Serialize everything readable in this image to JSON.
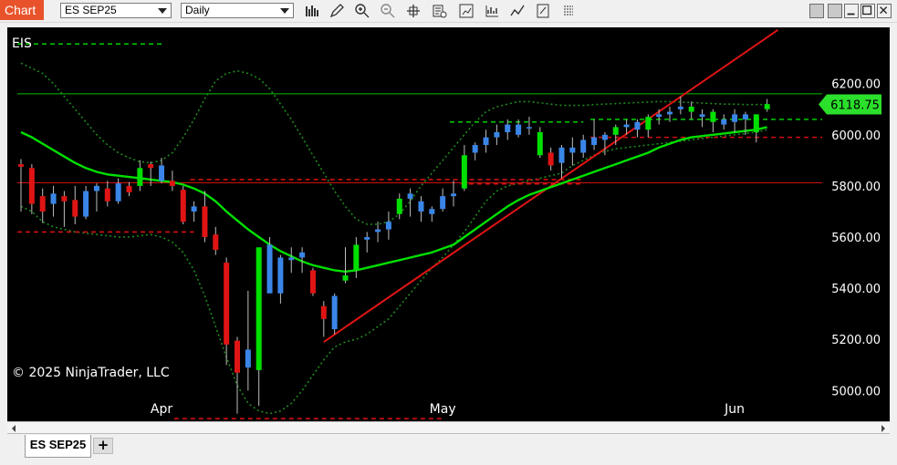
{
  "window": {
    "title_tab": "Chart",
    "instrument_value": "ES SEP25",
    "interval_value": "Daily"
  },
  "toolbar_icons": [
    "bars-icon",
    "pencil-icon",
    "zoom-in-icon",
    "zoom-out-icon",
    "crosshair-icon",
    "data-box-icon",
    "strategies-icon",
    "indicators-icon",
    "drawing-tools-icon",
    "properties-icon",
    "more-icon"
  ],
  "window_buttons": [
    "minimize-grey-icon",
    "minimize-icon",
    "maximize-icon",
    "close-icon"
  ],
  "chart_data": {
    "type": "candlestick",
    "symbol_label": "EIS",
    "copyright": "© 2025 NinjaTrader, LLC",
    "last_price": "6118.75",
    "y_ticks": [
      "6200.00",
      "6000.00",
      "5800.00",
      "5600.00",
      "5400.00",
      "5200.00",
      "5000.00"
    ],
    "x_ticks": [
      "Apr",
      "May",
      "Jun"
    ],
    "ylim": [
      4880,
      6420
    ],
    "x_index_ticks": [
      13,
      39,
      66
    ],
    "colors": {
      "up": "#00e000",
      "down": "#e01414",
      "up_hollow": "#3a86e8",
      "sma": "#00e000",
      "bands": "#1f8a1f",
      "trendline": "#e01414",
      "hline_green": "#00c000",
      "hline_red": "#d01010",
      "price_tag": "#2be02b"
    },
    "candles": [
      {
        "o": 5885,
        "h": 5905,
        "l": 5700,
        "c": 5875,
        "col": "down"
      },
      {
        "o": 5870,
        "h": 5885,
        "l": 5690,
        "c": 5730,
        "col": "down"
      },
      {
        "o": 5760,
        "h": 5790,
        "l": 5655,
        "c": 5700,
        "col": "down"
      },
      {
        "o": 5730,
        "h": 5800,
        "l": 5680,
        "c": 5770,
        "col": "blue"
      },
      {
        "o": 5760,
        "h": 5780,
        "l": 5640,
        "c": 5740,
        "col": "down"
      },
      {
        "o": 5745,
        "h": 5800,
        "l": 5650,
        "c": 5680,
        "col": "down"
      },
      {
        "o": 5680,
        "h": 5800,
        "l": 5670,
        "c": 5780,
        "col": "blue"
      },
      {
        "o": 5780,
        "h": 5810,
        "l": 5700,
        "c": 5800,
        "col": "blue"
      },
      {
        "o": 5790,
        "h": 5820,
        "l": 5720,
        "c": 5740,
        "col": "down"
      },
      {
        "o": 5740,
        "h": 5830,
        "l": 5730,
        "c": 5810,
        "col": "blue"
      },
      {
        "o": 5800,
        "h": 5815,
        "l": 5760,
        "c": 5775,
        "col": "down"
      },
      {
        "o": 5800,
        "h": 5900,
        "l": 5780,
        "c": 5870,
        "col": "up"
      },
      {
        "o": 5870,
        "h": 5895,
        "l": 5800,
        "c": 5885,
        "col": "down"
      },
      {
        "o": 5880,
        "h": 5910,
        "l": 5810,
        "c": 5820,
        "col": "blue"
      },
      {
        "o": 5820,
        "h": 5860,
        "l": 5780,
        "c": 5800,
        "col": "down"
      },
      {
        "o": 5785,
        "h": 5800,
        "l": 5650,
        "c": 5660,
        "col": "down"
      },
      {
        "o": 5700,
        "h": 5740,
        "l": 5660,
        "c": 5720,
        "col": "blue"
      },
      {
        "o": 5720,
        "h": 5780,
        "l": 5580,
        "c": 5600,
        "col": "down"
      },
      {
        "o": 5610,
        "h": 5640,
        "l": 5530,
        "c": 5550,
        "col": "down"
      },
      {
        "o": 5500,
        "h": 5520,
        "l": 5100,
        "c": 5180,
        "col": "down"
      },
      {
        "o": 5195,
        "h": 5210,
        "l": 4910,
        "c": 5070,
        "col": "down"
      },
      {
        "o": 5090,
        "h": 5390,
        "l": 5000,
        "c": 5160,
        "col": "blue"
      },
      {
        "o": 5080,
        "h": 5520,
        "l": 4940,
        "c": 5560,
        "col": "up"
      },
      {
        "o": 5570,
        "h": 5600,
        "l": 5440,
        "c": 5380,
        "col": "blue"
      },
      {
        "o": 5380,
        "h": 5530,
        "l": 5340,
        "c": 5520,
        "col": "blue"
      },
      {
        "o": 5510,
        "h": 5560,
        "l": 5460,
        "c": 5520,
        "col": "blue"
      },
      {
        "o": 5520,
        "h": 5560,
        "l": 5460,
        "c": 5540,
        "col": "blue"
      },
      {
        "o": 5470,
        "h": 5480,
        "l": 5370,
        "c": 5380,
        "col": "down"
      },
      {
        "o": 5330,
        "h": 5350,
        "l": 5210,
        "c": 5280,
        "col": "down"
      },
      {
        "o": 5240,
        "h": 5380,
        "l": 5220,
        "c": 5370,
        "col": "blue"
      },
      {
        "o": 5430,
        "h": 5560,
        "l": 5420,
        "c": 5450,
        "col": "up"
      },
      {
        "o": 5470,
        "h": 5600,
        "l": 5440,
        "c": 5570,
        "col": "up"
      },
      {
        "o": 5590,
        "h": 5620,
        "l": 5540,
        "c": 5600,
        "col": "blue"
      },
      {
        "o": 5620,
        "h": 5660,
        "l": 5580,
        "c": 5630,
        "col": "blue"
      },
      {
        "o": 5630,
        "h": 5700,
        "l": 5590,
        "c": 5660,
        "col": "blue"
      },
      {
        "o": 5690,
        "h": 5770,
        "l": 5670,
        "c": 5750,
        "col": "up"
      },
      {
        "o": 5750,
        "h": 5790,
        "l": 5680,
        "c": 5770,
        "col": "blue"
      },
      {
        "o": 5740,
        "h": 5760,
        "l": 5660,
        "c": 5700,
        "col": "blue"
      },
      {
        "o": 5690,
        "h": 5720,
        "l": 5660,
        "c": 5710,
        "col": "blue"
      },
      {
        "o": 5710,
        "h": 5790,
        "l": 5700,
        "c": 5760,
        "col": "blue"
      },
      {
        "o": 5770,
        "h": 5820,
        "l": 5720,
        "c": 5760,
        "col": "blue"
      },
      {
        "o": 5790,
        "h": 5960,
        "l": 5780,
        "c": 5920,
        "col": "up"
      },
      {
        "o": 5930,
        "h": 5970,
        "l": 5900,
        "c": 5960,
        "col": "blue"
      },
      {
        "o": 5960,
        "h": 6020,
        "l": 5930,
        "c": 5990,
        "col": "blue"
      },
      {
        "o": 5990,
        "h": 6040,
        "l": 5960,
        "c": 6010,
        "col": "blue"
      },
      {
        "o": 6010,
        "h": 6060,
        "l": 5980,
        "c": 6040,
        "col": "blue"
      },
      {
        "o": 6040,
        "h": 6060,
        "l": 5990,
        "c": 6000,
        "col": "blue"
      },
      {
        "o": 6030,
        "h": 6070,
        "l": 6000,
        "c": 6030,
        "col": "blue"
      },
      {
        "o": 6010,
        "h": 6030,
        "l": 5910,
        "c": 5920,
        "col": "up"
      },
      {
        "o": 5930,
        "h": 5950,
        "l": 5860,
        "c": 5880,
        "col": "down"
      },
      {
        "o": 5890,
        "h": 5960,
        "l": 5830,
        "c": 5950,
        "col": "blue"
      },
      {
        "o": 5950,
        "h": 5990,
        "l": 5880,
        "c": 5930,
        "col": "blue"
      },
      {
        "o": 5930,
        "h": 6000,
        "l": 5910,
        "c": 5980,
        "col": "blue"
      },
      {
        "o": 5990,
        "h": 6060,
        "l": 5940,
        "c": 5960,
        "col": "blue"
      },
      {
        "o": 5980,
        "h": 6010,
        "l": 5920,
        "c": 6000,
        "col": "blue"
      },
      {
        "o": 6000,
        "h": 6040,
        "l": 5960,
        "c": 6030,
        "col": "up"
      },
      {
        "o": 6030,
        "h": 6060,
        "l": 6000,
        "c": 6040,
        "col": "blue"
      },
      {
        "o": 6020,
        "h": 6060,
        "l": 5990,
        "c": 6050,
        "col": "blue"
      },
      {
        "o": 6020,
        "h": 6080,
        "l": 5990,
        "c": 6070,
        "col": "up"
      },
      {
        "o": 6070,
        "h": 6100,
        "l": 6040,
        "c": 6080,
        "col": "blue"
      },
      {
        "o": 6080,
        "h": 6110,
        "l": 6050,
        "c": 6090,
        "col": "blue"
      },
      {
        "o": 6100,
        "h": 6150,
        "l": 6080,
        "c": 6110,
        "col": "blue"
      },
      {
        "o": 6110,
        "h": 6130,
        "l": 6060,
        "c": 6090,
        "col": "up"
      },
      {
        "o": 6080,
        "h": 6100,
        "l": 6030,
        "c": 6070,
        "col": "blue"
      },
      {
        "o": 6050,
        "h": 6100,
        "l": 6010,
        "c": 6090,
        "col": "up"
      },
      {
        "o": 6060,
        "h": 6080,
        "l": 6020,
        "c": 6040,
        "col": "blue"
      },
      {
        "o": 6050,
        "h": 6100,
        "l": 6010,
        "c": 6080,
        "col": "blue"
      },
      {
        "o": 6080,
        "h": 6090,
        "l": 6000,
        "c": 6060,
        "col": "blue"
      },
      {
        "o": 6010,
        "h": 6080,
        "l": 5970,
        "c": 6080,
        "col": "up"
      },
      {
        "o": 6100,
        "h": 6140,
        "l": 6090,
        "c": 6120,
        "col": "up"
      }
    ],
    "sma": [
      6010,
      5990,
      5965,
      5940,
      5915,
      5890,
      5870,
      5855,
      5845,
      5840,
      5835,
      5830,
      5825,
      5820,
      5815,
      5805,
      5790,
      5770,
      5740,
      5700,
      5665,
      5630,
      5600,
      5570,
      5545,
      5525,
      5505,
      5490,
      5480,
      5470,
      5465,
      5470,
      5480,
      5490,
      5500,
      5510,
      5520,
      5530,
      5540,
      5555,
      5570,
      5600,
      5630,
      5660,
      5690,
      5720,
      5745,
      5765,
      5780,
      5795,
      5810,
      5825,
      5840,
      5855,
      5870,
      5885,
      5900,
      5915,
      5930,
      5950,
      5965,
      5980,
      5990,
      5995,
      6000,
      6005,
      6010,
      6015,
      6020,
      6030
    ],
    "band_upper": [
      6280,
      6260,
      6240,
      6200,
      6150,
      6100,
      6050,
      6000,
      5960,
      5930,
      5910,
      5895,
      5890,
      5900,
      5930,
      5990,
      6060,
      6140,
      6210,
      6240,
      6250,
      6240,
      6220,
      6180,
      6120,
      6060,
      5990,
      5920,
      5850,
      5780,
      5720,
      5670,
      5650,
      5650,
      5660,
      5690,
      5740,
      5800,
      5850,
      5900,
      5950,
      6000,
      6050,
      6090,
      6110,
      6120,
      6130,
      6130,
      6125,
      6120,
      6115,
      6115,
      6115,
      6118,
      6120,
      6122,
      6124,
      6126,
      6128,
      6130,
      6130,
      6128,
      6126,
      6124,
      6122,
      6120,
      6120,
      6118,
      6118,
      6118
    ],
    "band_lower": [
      5720,
      5700,
      5660,
      5640,
      5630,
      5620,
      5615,
      5610,
      5605,
      5600,
      5600,
      5605,
      5610,
      5600,
      5580,
      5540,
      5470,
      5370,
      5250,
      5130,
      5020,
      4950,
      4920,
      4910,
      4920,
      4950,
      5000,
      5060,
      5120,
      5170,
      5190,
      5200,
      5220,
      5250,
      5280,
      5330,
      5380,
      5430,
      5480,
      5520,
      5570,
      5620,
      5680,
      5740,
      5780,
      5800,
      5810,
      5820,
      5830,
      5840,
      5850,
      5880,
      5900,
      5920,
      5935,
      5945,
      5950,
      5955,
      5960,
      5965,
      5970,
      5975,
      5980,
      5985,
      5990,
      5995,
      6000,
      6005,
      6010,
      6020
    ],
    "hlines": [
      {
        "price": 6160,
        "style": "solid",
        "color": "green",
        "x0": 0,
        "x1": 69
      },
      {
        "price": 5812,
        "style": "solid",
        "color": "red",
        "x0": 0,
        "x1": 69
      },
      {
        "price": 6355,
        "style": "dashed",
        "color": "green",
        "x0": 0,
        "x1": 13
      },
      {
        "price": 5620,
        "style": "dashed",
        "color": "red",
        "x0": 0,
        "x1": 16
      },
      {
        "price": 4890,
        "style": "dashed",
        "color": "red",
        "x0": 14.5,
        "x1": 39
      },
      {
        "price": 5825,
        "style": "dashed",
        "color": "red",
        "x0": 16,
        "x1": 52
      },
      {
        "price": 6050,
        "style": "dashed",
        "color": "green",
        "x0": 40,
        "x1": 52
      },
      {
        "price": 5808,
        "style": "dashed",
        "color": "red",
        "x0": 41,
        "x1": 52
      },
      {
        "price": 6060,
        "style": "dashed",
        "color": "green",
        "x0": 53,
        "x1": 69
      },
      {
        "price": 5990,
        "style": "dashed",
        "color": "red",
        "x0": 53,
        "x1": 69
      }
    ],
    "trendline": {
      "from": {
        "i": 28,
        "p": 5190
      },
      "to": {
        "i": 70,
        "p": 6410
      }
    }
  }
}
